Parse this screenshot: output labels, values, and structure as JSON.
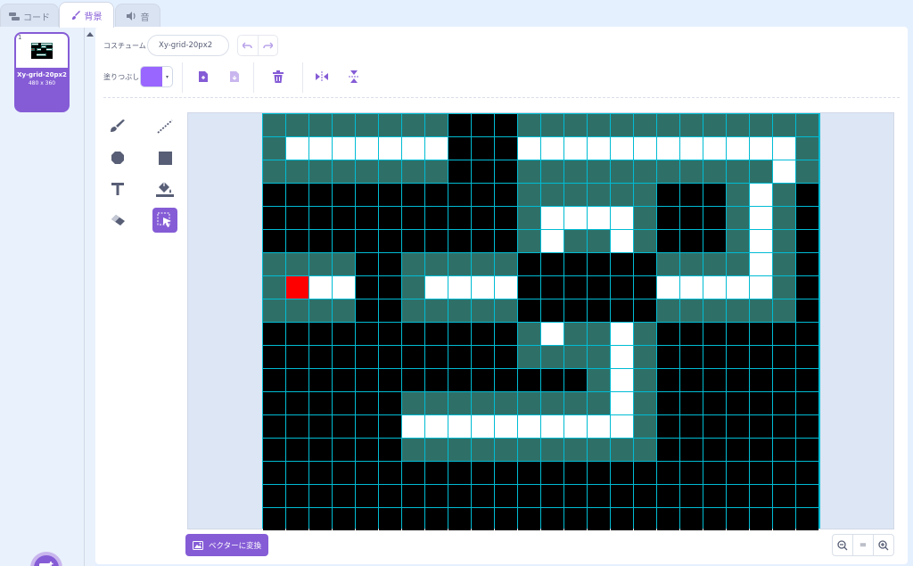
{
  "tabs": [
    {
      "label": "コード",
      "icon": "code-blocks-icon"
    },
    {
      "label": "背景",
      "icon": "paintbrush-icon"
    },
    {
      "label": "音",
      "icon": "speaker-icon"
    }
  ],
  "costume": {
    "number": "1",
    "name": "Xy-grid-20px2",
    "size": "480 x 360"
  },
  "toolbar": {
    "costume_label": "コスチューム",
    "costume_name": "Xy-grid-20px2",
    "fill_label": "塗りつぶし",
    "fill_color": "#9966ff"
  },
  "convert_label": "ベクターに変換",
  "zoom": {
    "out": "zoom-out-icon",
    "reset": "=",
    "in": "zoom-in-icon"
  },
  "colors": {
    "accent": "#855cd6",
    "teal": "#2e7068",
    "black": "#000000",
    "white": "#ffffff",
    "red": "#ff0000",
    "gridline": "#00bcd4"
  },
  "pixel_grid": {
    "columns": 24,
    "rows": 18,
    "legend": {
      "T": "teal",
      "B": "black",
      "W": "white",
      "R": "red"
    },
    "rows_data": [
      "TTTTTTTTBBBTTTTTTTTTTTTT",
      "TWWWWWWWBBBWWWWWWWWWWWWT",
      "TTTTTTTTBBBTTTTTTTTTTTWT",
      "BBBBBBBBBBBTTTTTTBBBTWT",
      "BBBBBBBBBBBTWWWWTBBBTWT",
      "BBBBBBBBBBBTWTTWTBBBTWT",
      "TTTTBBTTTTTBBBBBBTTTTWT",
      "TRWWBBTWWWWBBBBBBWWWWWT",
      "TTTTBBTTTTTBBBBBBTTTTTT",
      "BBBBBBBBBBBTWTTWTBBBBBB",
      "BBBBBBBBBBBTTTTWTBBBBBB",
      "BBBBBBBBBBBBBBTWTBBBBBB",
      "BBBBBBTTTTTTTTTWTBBBBBB",
      "BBBBBBWWWWWWWWWWTBBBBBB",
      "BBBBBBTTTTTTTTTTTBBBBBB",
      "BBBBBBBBBBBBBBBBBBBBBBB",
      "BBBBBBBBBBBBBBBBBBBBBBB",
      "BBBBBBBBBBBBBBBBBBBBBBB"
    ]
  }
}
